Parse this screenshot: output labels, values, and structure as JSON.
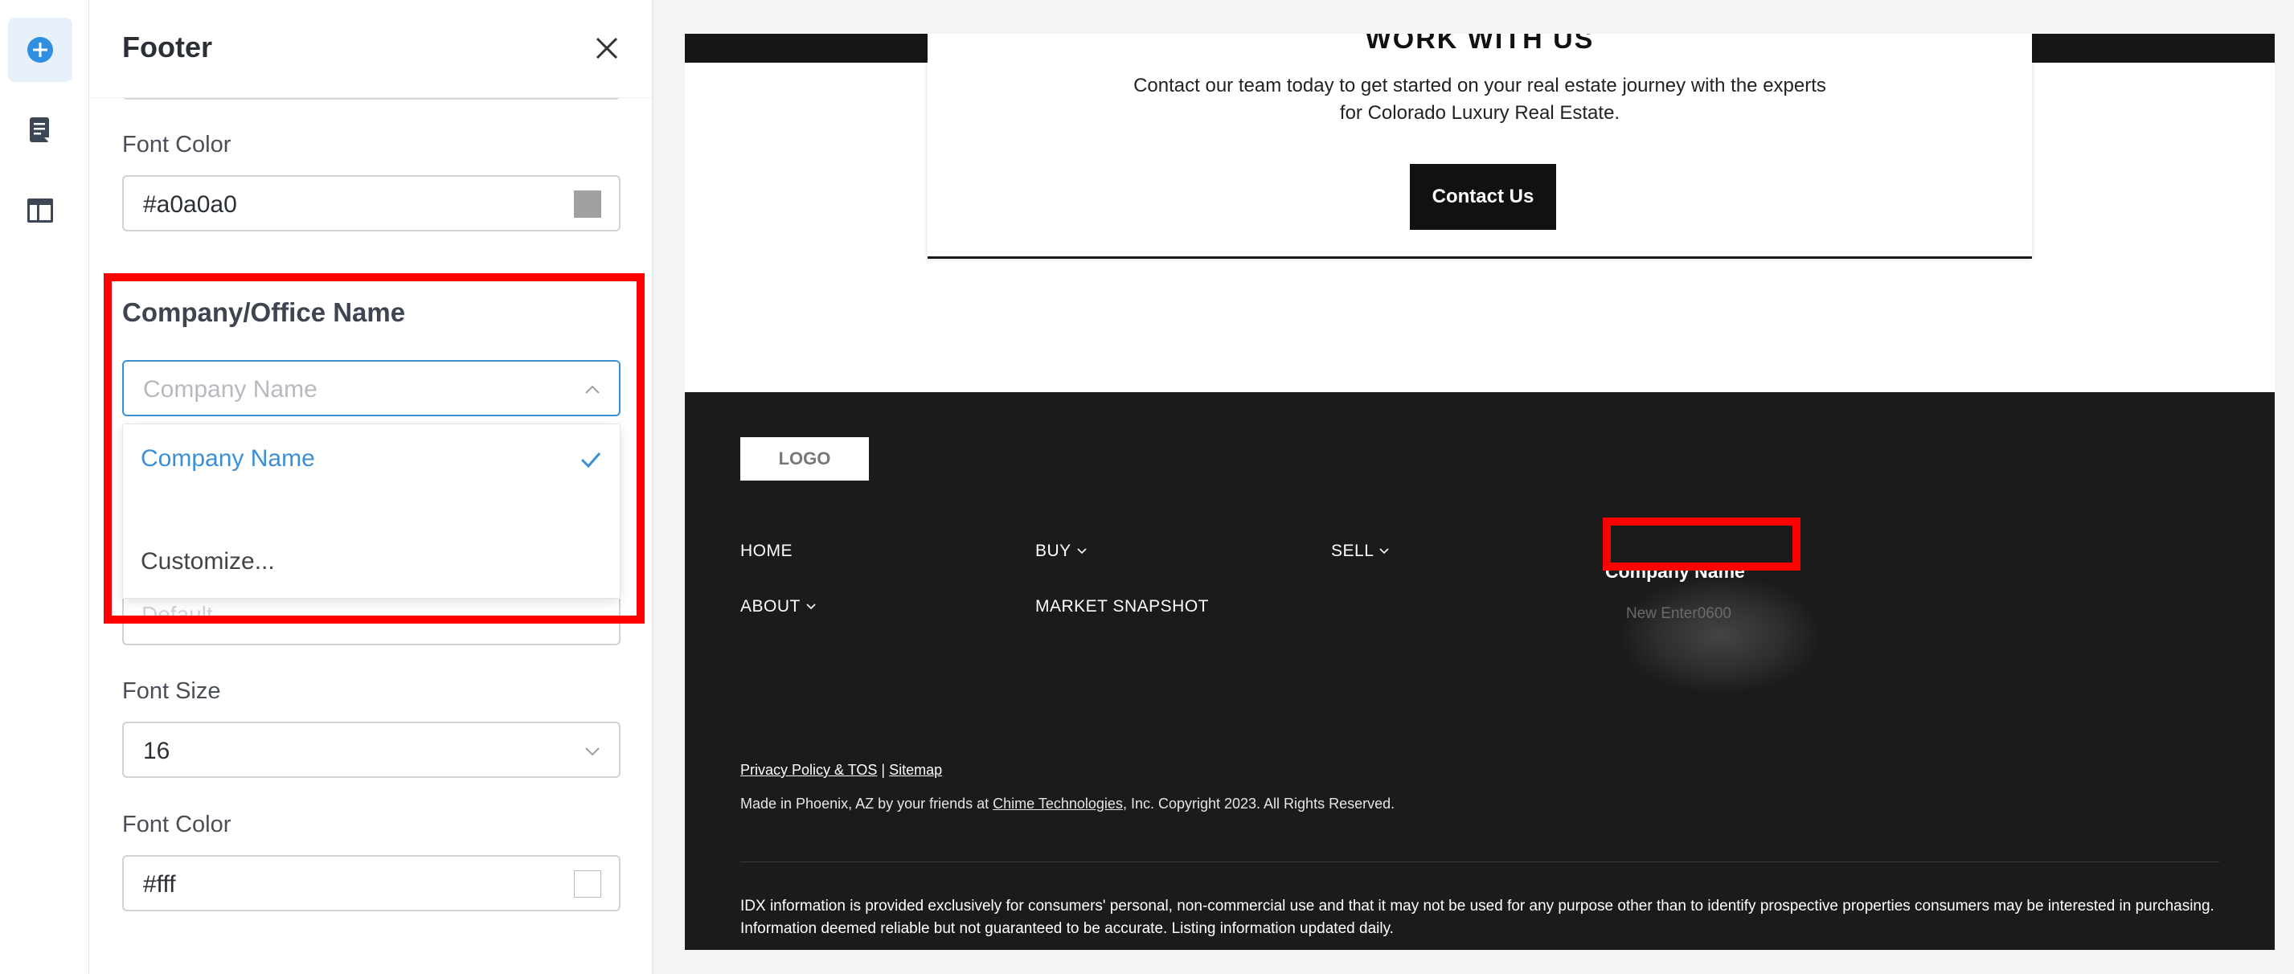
{
  "panel": {
    "title": "Footer",
    "font_color_label_1": "Font Color",
    "font_color_value_1": "#a0a0a0",
    "font_color_swatch_1": "#a0a0a0",
    "company_section_title": "Company/Office Name",
    "company_select_placeholder": "Company Name",
    "company_options": [
      {
        "label": "Company Name",
        "selected": true
      },
      {
        "label": "Customize...",
        "selected": false
      }
    ],
    "hidden_field_ghost": "Default",
    "font_size_label": "Font Size",
    "font_size_value": "16",
    "font_color_label_2": "Font Color",
    "font_color_value_2": "#fff",
    "font_color_swatch_2": "#ffffff"
  },
  "preview": {
    "card_heading": "WORK WITH US",
    "card_text": "Contact our team today to get started on your real estate journey with the experts for Colorado Luxury Real Estate.",
    "contact_button": "Contact Us",
    "logo": "LOGO",
    "nav": [
      "HOME",
      "BUY",
      "SELL",
      "ABOUT",
      "MARKET SNAPSHOT"
    ],
    "company_name": "Company Name",
    "blurred_text": "New Enter0600",
    "privacy_link": "Privacy Policy & TOS",
    "separator": "|",
    "sitemap_link": "Sitemap",
    "made_prefix": "Made in Phoenix, AZ by your friends at ",
    "made_link": "Chime Technologies",
    "made_suffix": ", Inc. Copyright 2023. All Rights Reserved.",
    "idx_text": "IDX information is provided exclusively for consumers' personal, non-commercial use and that it may not be used for any purpose other than to identify prospective properties consumers may be interested in purchasing. Information deemed reliable but not guaranteed to be accurate. Listing information updated daily."
  },
  "colors": {
    "accent": "#3a8fd6",
    "highlight": "#ff0000",
    "footer_bg": "#1b1b1b"
  },
  "icons": [
    "plus-circle-icon",
    "page-icon",
    "layout-icon",
    "close-icon",
    "chevron-up-icon",
    "chevron-down-icon",
    "check-icon"
  ]
}
